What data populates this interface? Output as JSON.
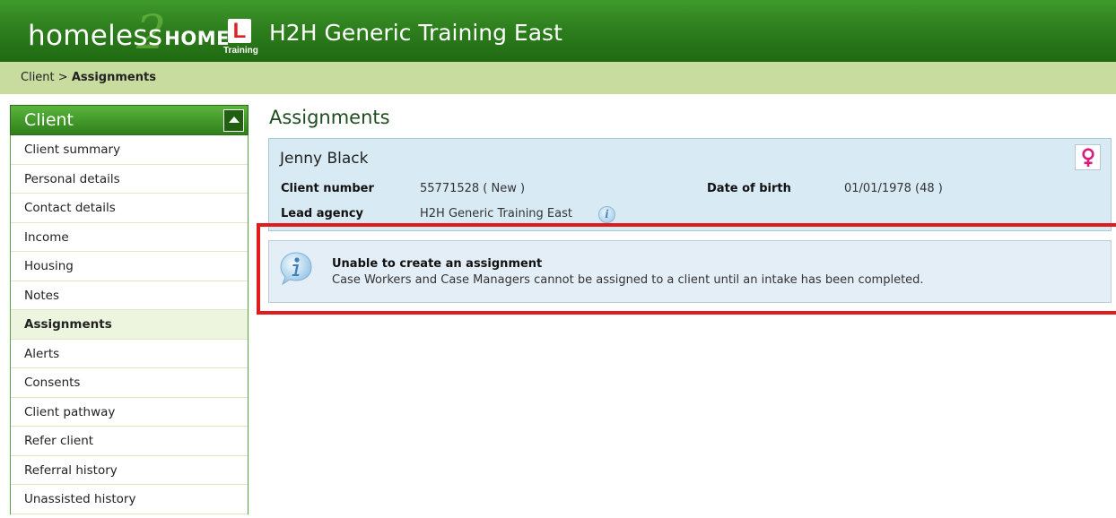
{
  "header": {
    "logo_word1": "homeless",
    "logo_numeral": "2",
    "logo_word2": "HOME",
    "learner_plate": "L",
    "training_tag": "Training",
    "app_title": "H2H Generic Training East"
  },
  "breadcrumb": {
    "parent": "Client",
    "separator": " > ",
    "current": "Assignments"
  },
  "sidebar": {
    "header": "Client",
    "items": [
      {
        "label": "Client summary",
        "active": false
      },
      {
        "label": "Personal details",
        "active": false
      },
      {
        "label": "Contact details",
        "active": false
      },
      {
        "label": "Income",
        "active": false
      },
      {
        "label": "Housing",
        "active": false
      },
      {
        "label": "Notes",
        "active": false
      },
      {
        "label": "Assignments",
        "active": true
      },
      {
        "label": "Alerts",
        "active": false
      },
      {
        "label": "Consents",
        "active": false
      },
      {
        "label": "Client pathway",
        "active": false
      },
      {
        "label": "Refer client",
        "active": false
      },
      {
        "label": "Referral history",
        "active": false
      },
      {
        "label": "Unassisted history",
        "active": false
      }
    ]
  },
  "main": {
    "title": "Assignments",
    "client": {
      "name": "Jenny Black",
      "gender_icon": "female-icon",
      "client_number_label": "Client number",
      "client_number_value": "55771528 ( New )",
      "dob_label": "Date of birth",
      "dob_value": "01/01/1978 (48 )",
      "lead_agency_label": "Lead agency",
      "lead_agency_value": "H2H Generic Training East"
    },
    "message": {
      "title": "Unable to create an assignment",
      "text": "Case Workers and Case Managers cannot be assigned to a client until an intake has been completed."
    }
  },
  "colors": {
    "header_green": "#2e7f1d",
    "breadcrumb_bg": "#c9dc9f",
    "panel_blue": "#d8eaf3",
    "highlight_red": "#e01b1b",
    "gender_pink": "#d81e78"
  }
}
